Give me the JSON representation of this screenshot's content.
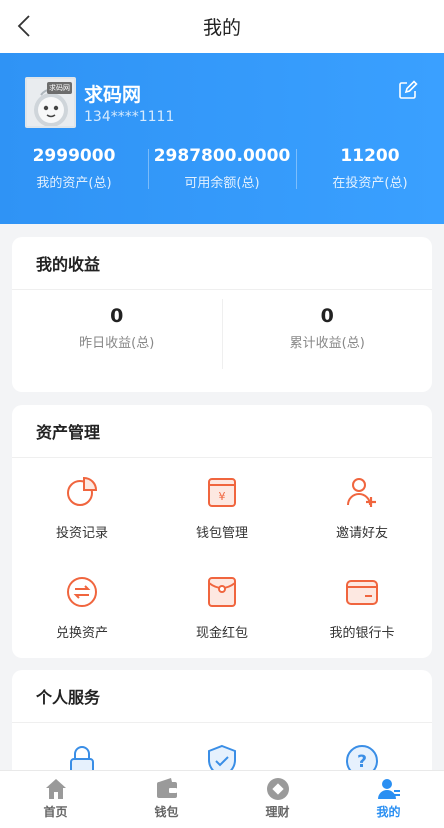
{
  "header": {
    "title": "我的"
  },
  "user": {
    "name": "求码网",
    "phone": "134****1111",
    "avatar_tag": "求码网"
  },
  "stats": [
    {
      "value": "2999000",
      "label": "我的资产(总)"
    },
    {
      "value": "2987800.0000",
      "label": "可用余额(总)"
    },
    {
      "value": "11200",
      "label": "在投资产(总)"
    }
  ],
  "income": {
    "title": "我的收益",
    "items": [
      {
        "value": "0",
        "label": "昨日收益(总)"
      },
      {
        "value": "0",
        "label": "累计收益(总)"
      }
    ]
  },
  "assets": {
    "title": "资产管理",
    "items": [
      {
        "label": "投资记录",
        "icon": "pie-chart-icon"
      },
      {
        "label": "钱包管理",
        "icon": "wallet-icon"
      },
      {
        "label": "邀请好友",
        "icon": "add-user-icon"
      },
      {
        "label": "兑换资产",
        "icon": "exchange-icon"
      },
      {
        "label": "现金红包",
        "icon": "red-envelope-icon"
      },
      {
        "label": "我的银行卡",
        "icon": "bank-card-icon"
      }
    ]
  },
  "services": {
    "title": "个人服务",
    "items": [
      {
        "label": "",
        "icon": "lock-icon"
      },
      {
        "label": "",
        "icon": "shield-icon"
      },
      {
        "label": "",
        "icon": "help-icon"
      }
    ]
  },
  "nav": [
    {
      "label": "首页",
      "icon": "home-icon",
      "active": false
    },
    {
      "label": "钱包",
      "icon": "wallet-icon",
      "active": false
    },
    {
      "label": "理财",
      "icon": "finance-icon",
      "active": false
    },
    {
      "label": "我的",
      "icon": "user-icon",
      "active": true
    }
  ],
  "colors": {
    "primary": "#2f93f5",
    "accent_orange": "#f0653e",
    "nav_active": "#2a8ff2",
    "nav_inactive": "#9a9a9a"
  }
}
